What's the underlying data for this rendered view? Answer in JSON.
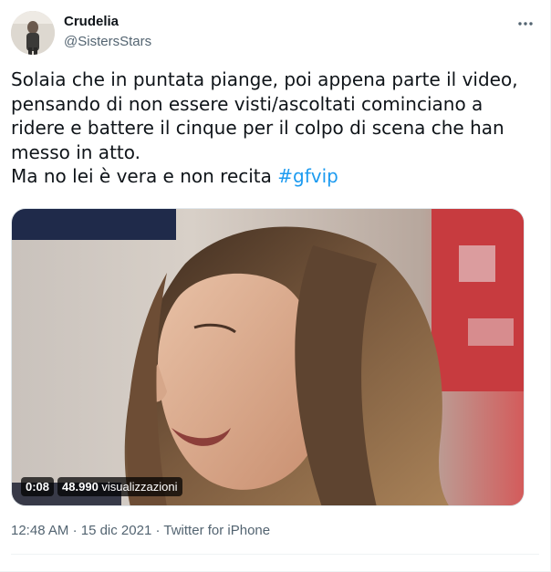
{
  "author": {
    "display_name": "Crudelia",
    "handle": "@SistersStars",
    "avatar_icon": "profile-avatar"
  },
  "menu": {
    "icon": "more-dots-icon"
  },
  "tweet": {
    "lines": [
      "Solaia che in puntata piange, poi appena parte il video,",
      "pensando di non essere visti/ascoltati cominciano a",
      "ridere e battere il cinque per il colpo di scena che han",
      "messo in atto."
    ],
    "last_line_text": "Ma no lei è vera e non recita ",
    "hashtag": "#gfvip"
  },
  "media": {
    "type": "video",
    "duration": "0:08",
    "views_count": "48.990",
    "views_label": "visualizzazioni"
  },
  "meta": {
    "time": "12:48 AM",
    "separator": "·",
    "date": "15 dic 2021",
    "source": "Twitter for iPhone"
  },
  "colors": {
    "link": "#1d9bf0",
    "text": "#0f1419",
    "secondary": "#536471"
  }
}
